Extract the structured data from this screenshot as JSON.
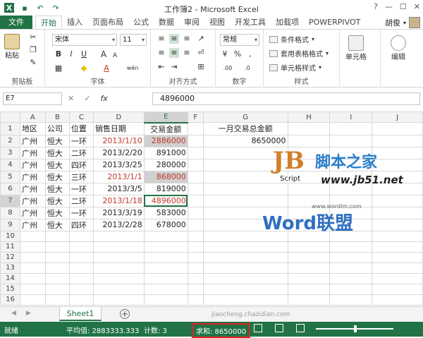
{
  "window": {
    "title": "工作簿2 - Microsoft Excel",
    "controls": [
      "?",
      "—",
      "☐",
      "✕"
    ]
  },
  "tabs": [
    "文件",
    "开始",
    "插入",
    "页面布局",
    "公式",
    "数据",
    "审阅",
    "视图",
    "开发工具",
    "加载项",
    "POWERPIVOT"
  ],
  "user": {
    "name": "胡俊"
  },
  "ribbon": {
    "clipboard": {
      "paste": "粘贴",
      "label": "剪贴板"
    },
    "font": {
      "name": "宋体",
      "size": "11",
      "label": "字体",
      "bold": "B",
      "italic": "I",
      "underline": "U",
      "grow": "A",
      "shrink": "A",
      "wen": "wén",
      "fontcolor": "A"
    },
    "alignment": {
      "label": "对齐方式"
    },
    "number": {
      "format": "常规",
      "label": "数字",
      "percent": "%",
      "comma": ",",
      "increase": ".00",
      "decrease": ".0"
    },
    "styles": {
      "conditional": "条件格式",
      "table": "套用表格格式",
      "cell": "单元格样式",
      "label": "样式"
    },
    "cells": {
      "label": "单元格"
    },
    "editing": {
      "label": "编辑"
    }
  },
  "formula_bar": {
    "namebox": "E7",
    "cancel": "✕",
    "enter": "✓",
    "fx": "fx",
    "value": "4896000"
  },
  "sheet": {
    "columns": [
      "A",
      "B",
      "C",
      "D",
      "E",
      "F",
      "G",
      "H",
      "I",
      "J"
    ],
    "rows": [
      {
        "n": "1",
        "cells": [
          "地区",
          "公司",
          "位置",
          "销售日期",
          "交易金额",
          "",
          "一月交易总金额",
          "",
          "",
          ""
        ]
      },
      {
        "n": "2",
        "cells": [
          "广州",
          "恒大",
          "一环",
          "2013/1/10",
          "2886000",
          "",
          "8650000",
          "",
          "",
          ""
        ]
      },
      {
        "n": "3",
        "cells": [
          "广州",
          "恒大",
          "二环",
          "2013/2/20",
          "891000",
          "",
          "",
          "",
          "",
          ""
        ]
      },
      {
        "n": "4",
        "cells": [
          "广州",
          "恒大",
          "四环",
          "2013/3/25",
          "280000",
          "",
          "",
          "",
          "",
          ""
        ]
      },
      {
        "n": "5",
        "cells": [
          "广州",
          "恒大",
          "三环",
          "2013/1/1",
          "868000",
          "",
          "",
          "",
          "",
          ""
        ]
      },
      {
        "n": "6",
        "cells": [
          "广州",
          "恒大",
          "一环",
          "2013/3/5",
          "819000",
          "",
          "",
          "",
          "",
          ""
        ]
      },
      {
        "n": "7",
        "cells": [
          "广州",
          "恒大",
          "二环",
          "2013/1/18",
          "4896000",
          "",
          "",
          "",
          "",
          ""
        ]
      },
      {
        "n": "8",
        "cells": [
          "广州",
          "恒大",
          "一环",
          "2013/3/19",
          "583000",
          "",
          "",
          "",
          "",
          ""
        ]
      },
      {
        "n": "9",
        "cells": [
          "广州",
          "恒大",
          "四环",
          "2013/2/28",
          "678000",
          "",
          "",
          "",
          "",
          ""
        ]
      },
      {
        "n": "10",
        "cells": [
          "",
          "",
          "",
          "",
          "",
          "",
          "",
          "",
          "",
          ""
        ]
      },
      {
        "n": "11",
        "cells": [
          "",
          "",
          "",
          "",
          "",
          "",
          "",
          "",
          "",
          ""
        ]
      },
      {
        "n": "12",
        "cells": [
          "",
          "",
          "",
          "",
          "",
          "",
          "",
          "",
          "",
          ""
        ]
      },
      {
        "n": "13",
        "cells": [
          "",
          "",
          "",
          "",
          "",
          "",
          "",
          "",
          "",
          ""
        ]
      },
      {
        "n": "14",
        "cells": [
          "",
          "",
          "",
          "",
          "",
          "",
          "",
          "",
          "",
          ""
        ]
      },
      {
        "n": "15",
        "cells": [
          "",
          "",
          "",
          "",
          "",
          "",
          "",
          "",
          "",
          ""
        ]
      },
      {
        "n": "16",
        "cells": [
          "",
          "",
          "",
          "",
          "",
          "",
          "",
          "",
          "",
          ""
        ]
      }
    ],
    "tab": "Sheet1",
    "add": "+"
  },
  "status": {
    "ready": "就绪",
    "average": "平均值: 2883333.333",
    "count": "计数: 3",
    "sum": "求和: 8650000"
  },
  "watermarks": {
    "site_cn": "脚本之家",
    "site_en": "www.jb51.net",
    "script": "Script",
    "word": "Word联盟",
    "word_url": "www.wordlm.com",
    "jb": "JB",
    "bottom": "jiaocheng.chazidian.com"
  },
  "colors": {
    "accent": "#217346",
    "red_text": "#c0392b",
    "highlight": "#d0d0d0",
    "sum_border": "#e02020"
  }
}
